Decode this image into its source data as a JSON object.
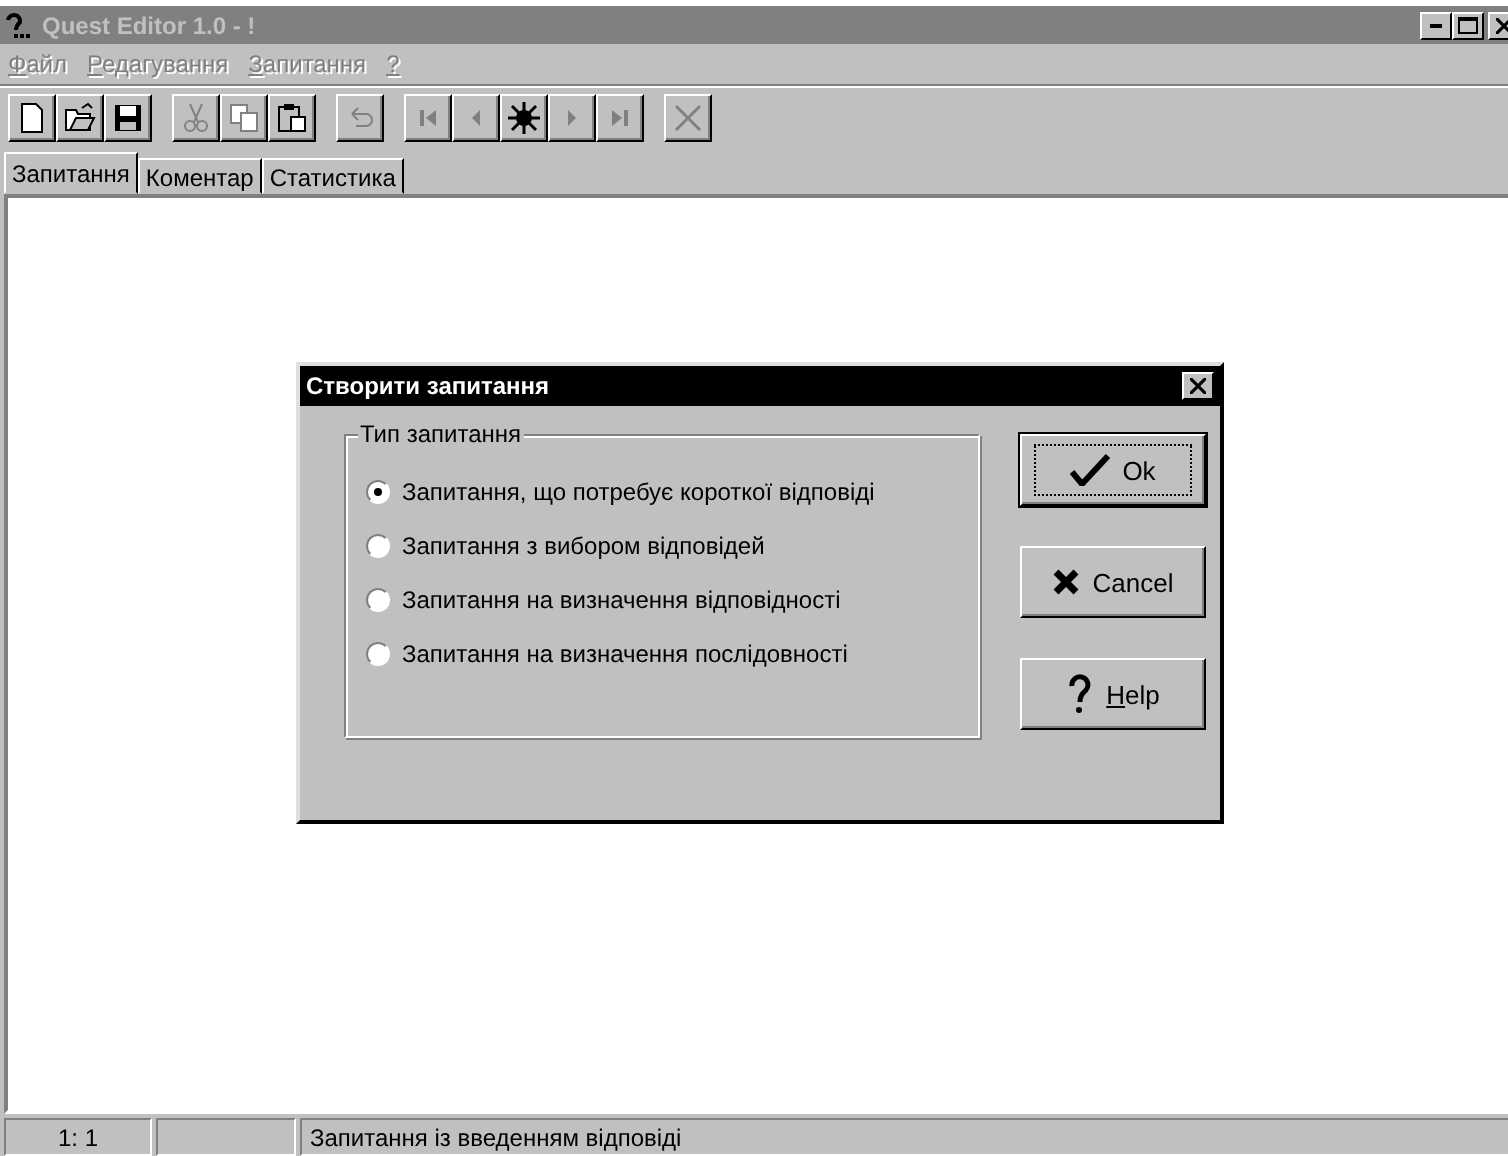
{
  "window": {
    "title": "Quest Editor 1.0 - !",
    "active": false
  },
  "menu": [
    {
      "mnemonic": "Ф",
      "rest": "айл",
      "disabled": true
    },
    {
      "mnemonic": "Р",
      "rest": "едагування",
      "disabled": true
    },
    {
      "mnemonic": "З",
      "rest": "апитання",
      "disabled": true
    },
    {
      "mnemonic": "?",
      "disabled": true
    }
  ],
  "toolbar": [
    [
      {
        "kind": "new",
        "disabled": false
      },
      {
        "kind": "open",
        "disabled": false
      },
      {
        "kind": "save",
        "disabled": false
      }
    ],
    [
      {
        "kind": "cut",
        "disabled": true
      },
      {
        "kind": "copy",
        "disabled": true
      },
      {
        "kind": "paste",
        "disabled": false
      }
    ],
    [
      {
        "kind": "undo",
        "disabled": true
      }
    ],
    [
      {
        "kind": "first",
        "disabled": true
      },
      {
        "kind": "prev",
        "disabled": true
      },
      {
        "kind": "new-item",
        "disabled": false
      },
      {
        "kind": "next",
        "disabled": true
      },
      {
        "kind": "last",
        "disabled": true
      }
    ],
    [
      {
        "kind": "delete",
        "disabled": true
      }
    ]
  ],
  "tabs": [
    {
      "label": "Запитання",
      "selected": true
    },
    {
      "label": "Коментар",
      "selected": false
    },
    {
      "label": "Статистика",
      "selected": false
    }
  ],
  "dialog": {
    "title": "Створити запитання",
    "group_label": "Тип запитання",
    "options": [
      {
        "label": "Запитання, що потребує короткої відповіді",
        "selected": true
      },
      {
        "label": "Запитання з вибором відповідей",
        "selected": false
      },
      {
        "label": "Запитання на визначення відповідності",
        "selected": false
      },
      {
        "label": "Запитання на визначення послідовності",
        "selected": false
      }
    ],
    "buttons": [
      {
        "kind": "ok",
        "rest": "Ok",
        "default": true
      },
      {
        "kind": "cancel",
        "rest": "Cancel",
        "default": false
      },
      {
        "kind": "help",
        "mnemonic": "H",
        "rest": "elp",
        "default": false
      }
    ]
  },
  "status_bar": {
    "position": "1: 1",
    "message": "Запитання із введенням відповіді"
  }
}
